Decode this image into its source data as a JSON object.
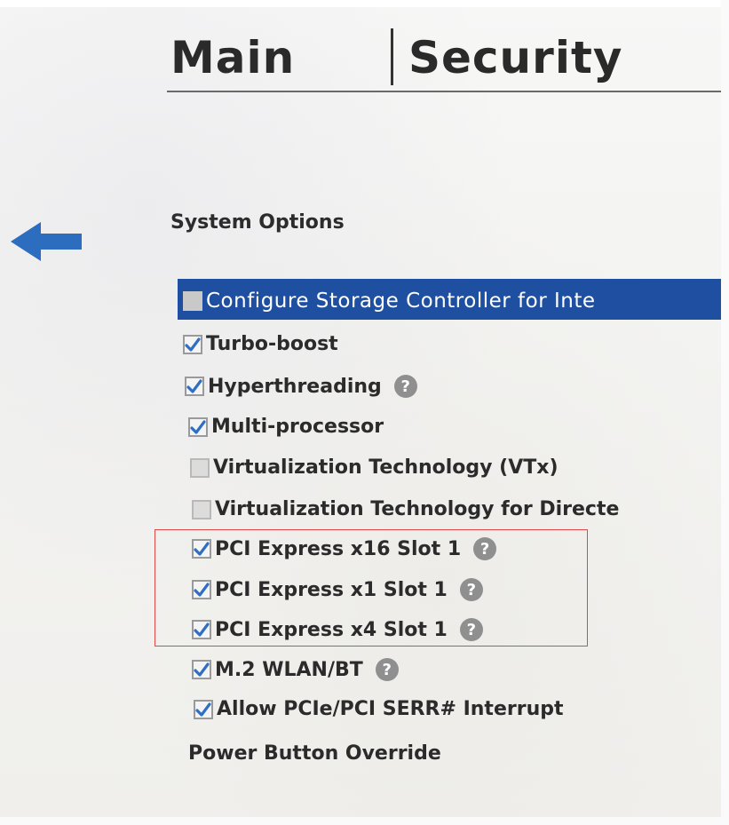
{
  "tabs": [
    {
      "label": "Main"
    },
    {
      "label": "Security"
    }
  ],
  "section": {
    "title": "System Options"
  },
  "options": [
    {
      "label": "Configure Storage Controller for Inte",
      "checked": false,
      "selected": true,
      "help": false
    },
    {
      "label": "Turbo-boost",
      "checked": true,
      "selected": false,
      "help": false
    },
    {
      "label": "Hyperthreading",
      "checked": true,
      "selected": false,
      "help": true
    },
    {
      "label": "Multi-processor",
      "checked": true,
      "selected": false,
      "help": false
    },
    {
      "label": "Virtualization Technology (VTx)",
      "checked": false,
      "selected": false,
      "help": false
    },
    {
      "label": "Virtualization Technology for Directe",
      "checked": false,
      "selected": false,
      "help": false
    },
    {
      "label": "PCI Express x16 Slot 1",
      "checked": true,
      "selected": false,
      "help": true
    },
    {
      "label": "PCI Express x1 Slot 1",
      "checked": true,
      "selected": false,
      "help": true
    },
    {
      "label": "PCI Express x4 Slot 1",
      "checked": true,
      "selected": false,
      "help": true
    },
    {
      "label": "M.2 WLAN/BT",
      "checked": true,
      "selected": false,
      "help": true
    },
    {
      "label": "Allow PCIe/PCI SERR# Interrupt",
      "checked": true,
      "selected": false,
      "help": false
    }
  ],
  "power_button": {
    "label": "Power Button Override"
  },
  "help_glyph": "?",
  "colors": {
    "highlight": "#1e4fa0",
    "checkmark": "#2e6fc4",
    "arrow": "#2d6dbf",
    "annotation_box": "#e04848"
  },
  "icons": {
    "back": "arrow-left-icon",
    "help": "question-circle-icon",
    "check": "checkmark-icon"
  }
}
